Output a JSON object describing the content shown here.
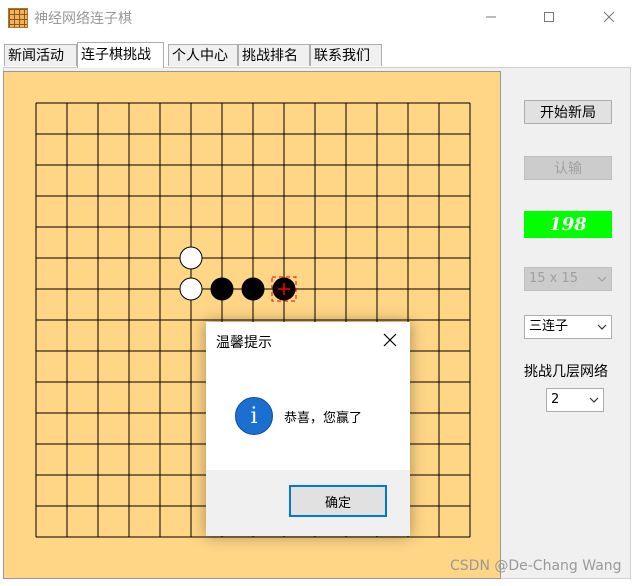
{
  "window": {
    "title": "神经网络连子棋"
  },
  "tabs": [
    {
      "label": "新闻活动",
      "active": false
    },
    {
      "label": "连子棋挑战",
      "active": true
    },
    {
      "label": "个人中心",
      "active": false
    },
    {
      "label": "挑战排名",
      "active": false
    },
    {
      "label": "联系我们",
      "active": false
    }
  ],
  "board": {
    "size": 15,
    "stones": [
      {
        "col": 5,
        "row": 5,
        "color": "white"
      },
      {
        "col": 5,
        "row": 6,
        "color": "white"
      },
      {
        "col": 6,
        "row": 6,
        "color": "black"
      },
      {
        "col": 7,
        "row": 6,
        "color": "black"
      },
      {
        "col": 8,
        "row": 6,
        "color": "black",
        "last_move": true
      }
    ]
  },
  "sidebar": {
    "new_game_label": "开始新局",
    "resign_label": "认输",
    "timer_value": "198",
    "board_size_value": "15 x 15",
    "mode_value": "三连子",
    "network_layers_label": "挑战几层网络",
    "network_layers_value": "2"
  },
  "dialog": {
    "title": "温馨提示",
    "message": "恭喜，您赢了",
    "icon": "info-icon",
    "ok_label": "确定"
  },
  "watermark": "CSDN @De-Chang Wang",
  "colors": {
    "board": "#ffd586",
    "timer_bg": "#00ff00",
    "accent": "#0078d7",
    "last_move_marker": "#ff0000"
  }
}
